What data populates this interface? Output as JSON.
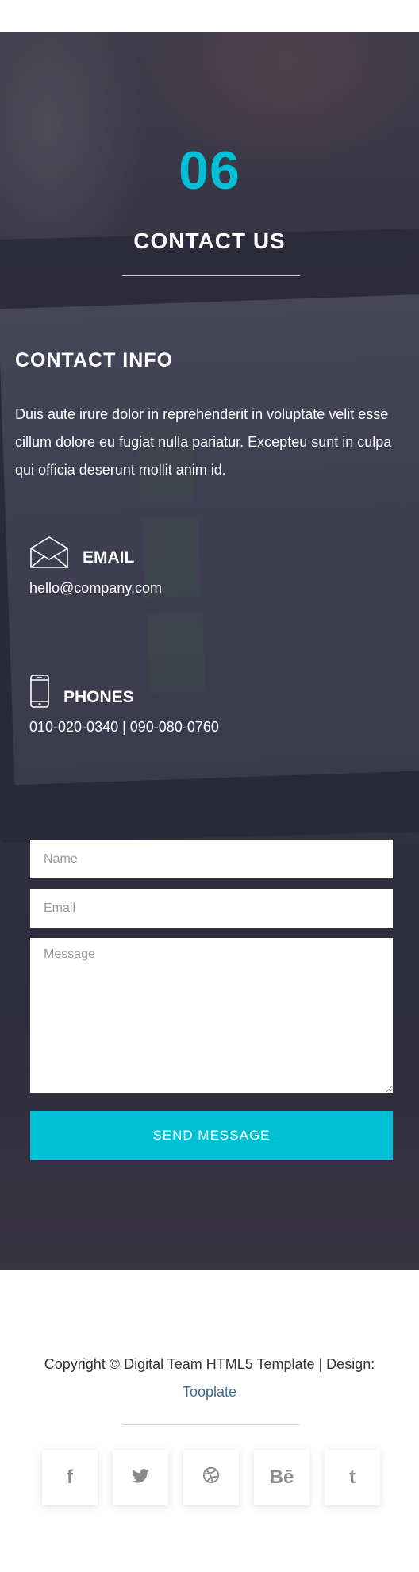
{
  "section": {
    "number": "06",
    "title": "CONTACT US"
  },
  "contact_info": {
    "heading": "CONTACT INFO",
    "text": "Duis aute irure dolor in reprehenderit in voluptate velit esse cillum dolore eu fugiat nulla pariatur. Excepteu sunt in culpa qui officia deserunt mollit anim id.",
    "email": {
      "icon": "envelope-icon",
      "label": "EMAIL",
      "value": "hello@company.com"
    },
    "phones": {
      "icon": "mobile-phone-icon",
      "label": "PHONES",
      "value": "010-020-0340 | 090-080-0760"
    }
  },
  "form": {
    "name_placeholder": "Name",
    "email_placeholder": "Email",
    "message_placeholder": "Message",
    "submit_label": "SEND MESSAGE"
  },
  "footer": {
    "copyright_text": "Copyright © Digital Team HTML5 Template | Design:",
    "credit_link": "Tooplate",
    "social": [
      {
        "icon": "facebook-icon",
        "glyph": "f"
      },
      {
        "icon": "twitter-icon",
        "glyph": ""
      },
      {
        "icon": "dribbble-icon",
        "glyph": ""
      },
      {
        "icon": "behance-icon",
        "glyph": "Bē"
      },
      {
        "icon": "tumblr-icon",
        "glyph": "t"
      }
    ]
  },
  "colors": {
    "accent": "#00c0d6",
    "link": "#3d6d8f",
    "footer_text": "#333333",
    "social_icon": "#8a8a8a"
  }
}
